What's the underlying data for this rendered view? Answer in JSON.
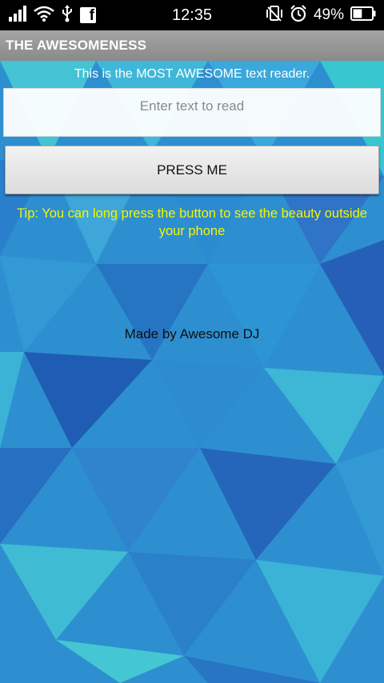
{
  "status_bar": {
    "time": "12:35",
    "battery_percent": "49%",
    "battery_level": 0.49,
    "facebook_glyph": "f",
    "icons_left": [
      "signal-icon",
      "wifi-icon",
      "usb-icon",
      "facebook-icon"
    ],
    "icons_right": [
      "vibrate-icon",
      "alarm-icon",
      "battery-icon"
    ]
  },
  "action_bar": {
    "title": "THE AWESOMENESS"
  },
  "main": {
    "headline": "This is the MOST AWESOME text reader.",
    "input": {
      "value": "",
      "placeholder": "Enter text to read"
    },
    "button_label": "PRESS ME",
    "tip": "Tip: You can long press the button to see the beauty outside your phone",
    "credit": "Made by Awesome DJ"
  },
  "colors": {
    "tip_text": "#f5f500",
    "headline_text": "#ffffff",
    "action_bar": "#999999",
    "background_primary": "#2a8fcf",
    "background_accent": "#3fc6d6"
  }
}
